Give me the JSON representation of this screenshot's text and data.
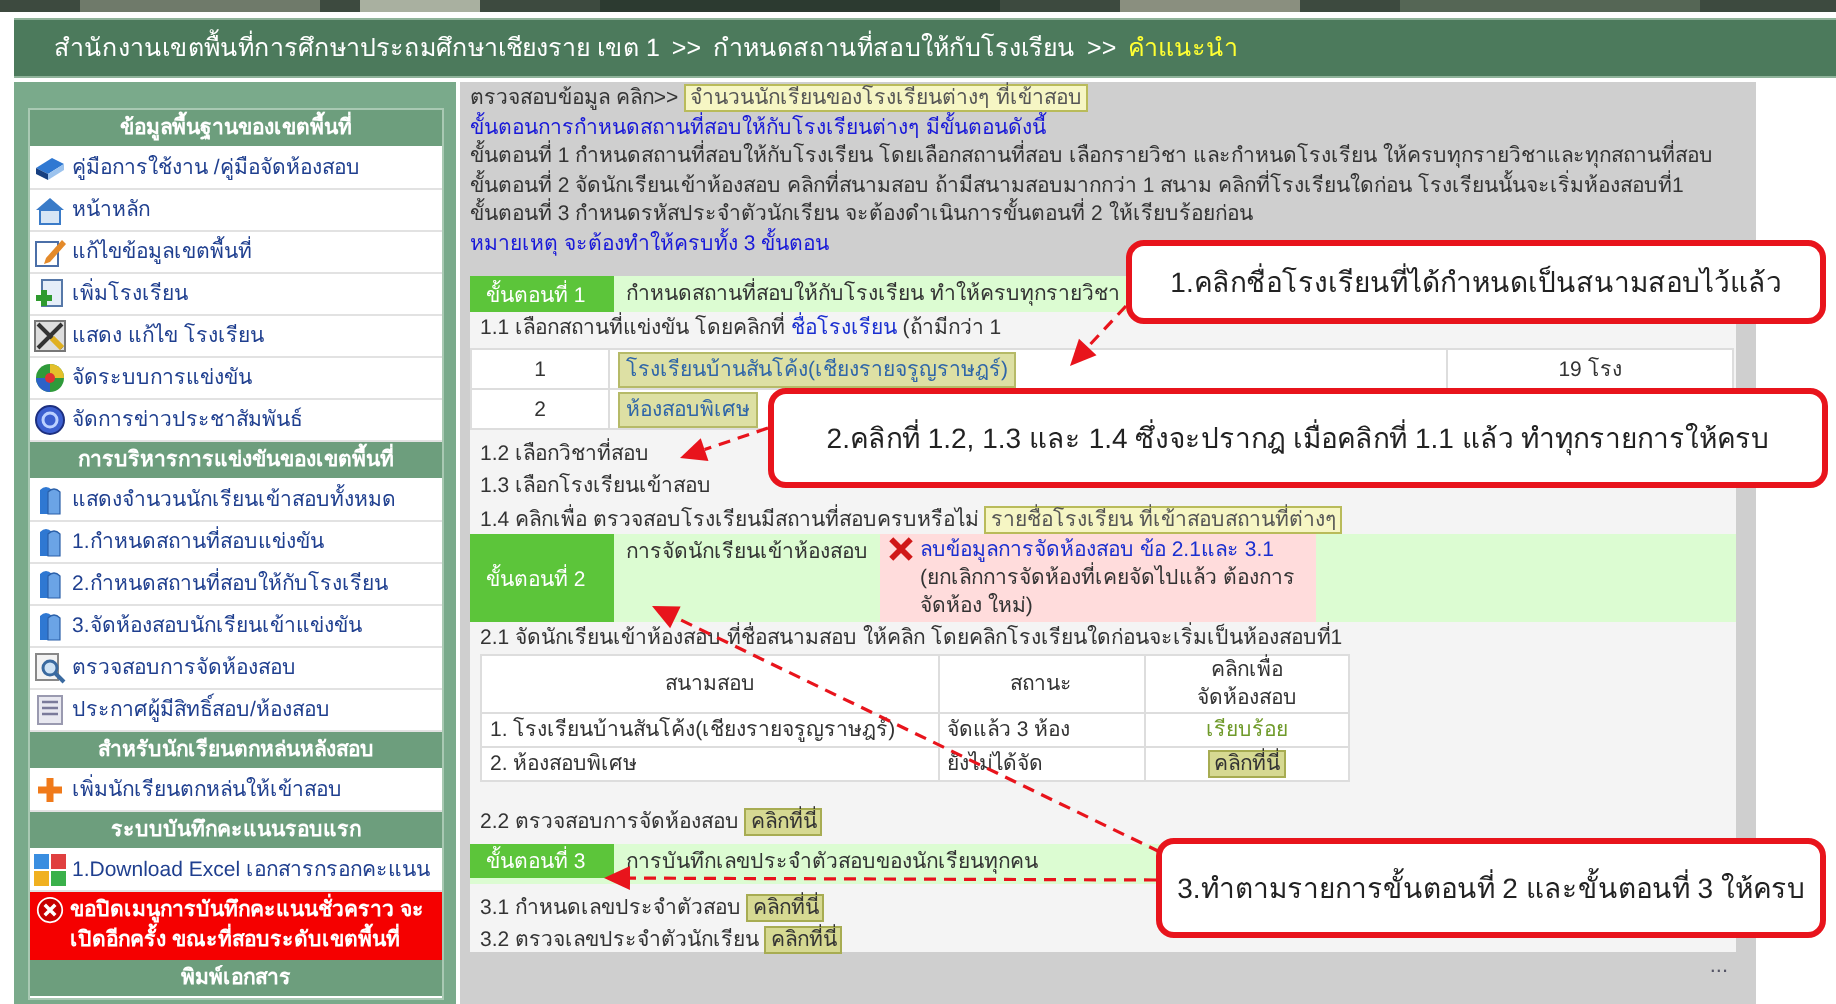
{
  "header": {
    "title": "สำนักงานเขตพื้นที่การศึกษาประถมศึกษาเชียงราย เขต 1",
    "crumbs": [
      {
        "separator": ">>",
        "label": "กำหนดสถานที่สอบให้กับโรงเรียน",
        "current": false
      },
      {
        "separator": ">>",
        "label": "คำแนะนำ",
        "current": true
      }
    ]
  },
  "sidebar": {
    "sections": [
      {
        "title": "ข้อมูลพื้นฐานของเขตพื้นที่",
        "items": [
          {
            "kind": "link",
            "label": "คู่มือการใช้งาน /คู่มือจัดห้องสอบ"
          },
          {
            "kind": "link",
            "label": "หน้าหลัก"
          },
          {
            "kind": "link",
            "label": "แก้ไขข้อมูลเขตพื้นที่"
          },
          {
            "kind": "link",
            "label": "เพิ่มโรงเรียน"
          },
          {
            "kind": "link",
            "label": "แสดง แก้ไข โรงเรียน"
          },
          {
            "kind": "link",
            "label": "จัดระบบการแข่งขัน"
          },
          {
            "kind": "link",
            "label": "จัดการข่าวประชาสัมพันธ์"
          }
        ]
      },
      {
        "title": "การบริหารการแข่งขันของเขตพื้นที่",
        "items": [
          {
            "kind": "link",
            "label": "แสดงจำนวนนักเรียนเข้าสอบทั้งหมด"
          },
          {
            "kind": "link",
            "label": "1.กำหนดสถานที่สอบแข่งขัน"
          },
          {
            "kind": "link",
            "label": "2.กำหนดสถานที่สอบให้กับโรงเรียน"
          },
          {
            "kind": "link",
            "label": "3.จัดห้องสอบนักเรียนเข้าแข่งขัน"
          },
          {
            "kind": "link",
            "label": "ตรวจสอบการจัดห้องสอบ"
          },
          {
            "kind": "link",
            "label": "ประกาศผู้มีสิทธิ์สอบ/ห้องสอบ"
          }
        ]
      },
      {
        "title": "สำหรับนักเรียนตกหล่นหลังสอบ",
        "items": [
          {
            "kind": "link",
            "label": "เพิ่มนักเรียนตกหล่นให้เข้าสอบ"
          }
        ]
      },
      {
        "title": "ระบบบันทึกคะแนนรอบแรก",
        "items": [
          {
            "kind": "link",
            "label": "1.Download Excel เอกสารกรอกคะแนน"
          },
          {
            "kind": "alert",
            "label": "ขอปิดเมนูการบันทึกคะแนนชั่วคราว จะเปิดอีกครั้ง ขณะที่สอบระดับเขตพื้นที่"
          }
        ]
      },
      {
        "title": "พิมพ์เอกสาร"
      }
    ]
  },
  "intro": {
    "prompt": "ตรวจสอบข้อมูล คลิก>>",
    "link": "จำนวนนักเรียนของโรงเรียนต่างๆ ที่เข้าสอบ",
    "heading": "ขั้นตอนการกำหนดสถานที่สอบให้กับโรงเรียนต่างๆ มีขั้นตอนดังนี้",
    "lines": [
      "ขั้นตอนที่ 1 กำหนดสถานที่สอบให้กับโรงเรียน โดยเลือกสถานที่สอบ เลือกรายวิชา และกำหนดโรงเรียน ให้ครบทุกรายวิชาและทุกสถานที่สอบ",
      "ขั้นตอนที่ 2 จัดนักเรียนเข้าห้องสอบ คลิกที่สนามสอบ ถ้ามีสนามสอบมากกว่า 1 สนาม คลิกที่โรงเรียนใดก่อน โรงเรียนนั้นจะเริ่มห้องสอบที่1",
      "ขั้นตอนที่ 3 กำหนดรหัสประจำตัวนักเรียน จะต้องดำเนินการขั้นตอนที่ 2 ให้เรียบร้อยก่อน"
    ],
    "note": "หมายเหตุ จะต้องทำให้ครบทั้ง 3 ขั้นตอน"
  },
  "step1": {
    "badge": "ขั้นตอนที่ 1",
    "title": "กำหนดสถานที่สอบให้กับโรงเรียน ทำให้ครบทุกรายวิชา",
    "choose_site": {
      "text": "1.1 เลือกสถานที่แข่งขัน โดยคลิกที่",
      "link": "ชื่อโรงเรียน",
      "after": "(ถ้ามีกว่า 1"
    },
    "sites": [
      {
        "no": "1",
        "name": "โรงเรียนบ้านสันโค้ง(เชียงรายจรูญราษฎร์)",
        "count": "19 โรง"
      },
      {
        "no": "2",
        "name": "ห้องสอบพิเศษ"
      }
    ],
    "choose_subject": "1.2 เลือกวิชาที่สอบ",
    "choose_school": "1.3 เลือกโรงเรียนเข้าสอบ",
    "check": {
      "text": "1.4 คลิกเพื่อ ตรวจสอบโรงเรียนมีสถานที่สอบครบหรือไม่",
      "link": "รายชื่อโรงเรียน ที่เข้าสอบสถานที่ต่างๆ"
    }
  },
  "step2": {
    "badge": "ขั้นตอนที่ 2",
    "title": "การจัดนักเรียนเข้าห้องสอบ",
    "delete": {
      "link": "ลบข้อมูลการจัดห้องสอบ ข้อ 2.1และ 3.1",
      "note": "(ยกเลิกการจัดห้องที่เคยจัดไปแล้ว ต้องการจัดห้อง ใหม่)"
    },
    "assign": "2.1 จัดนักเรียนเข้าห้องสอบ ที่ชื่อสนามสอบ ให้คลิก โดยคลิกโรงเรียนใดก่อนจะเริ่มเป็นห้องสอบที่1",
    "columns": [
      "สนามสอบ",
      "สถานะ",
      "คลิกเพื่อ\nจัดห้องสอบ"
    ],
    "rows": [
      {
        "site": "1. โรงเรียนบ้านสันโค้ง(เชียงรายจรูญราษฎร์)",
        "status": "จัดแล้ว 3 ห้อง",
        "action": {
          "kind": "done",
          "label": "เรียบร้อย"
        }
      },
      {
        "site": "2. ห้องสอบพิเศษ",
        "status": "ยังไม่ได้จัด",
        "action": {
          "kind": "button",
          "label": "คลิกที่นี่"
        }
      }
    ],
    "review": {
      "text": "2.2 ตรวจสอบการจัดห้องสอบ",
      "button": "คลิกที่นี่"
    }
  },
  "step3": {
    "badge": "ขั้นตอนที่ 3",
    "title": "การบันทึกเลขประจำตัวสอบของนักเรียนทุกคน",
    "actions": [
      {
        "text": "3.1 กำหนดเลขประจำตัวสอบ",
        "button": "คลิกที่นี่"
      },
      {
        "text": "3.2 ตรวจเลขประจำตัวนักเรียน",
        "button": "คลิกที่นี่"
      }
    ]
  },
  "more": "...",
  "callouts": [
    {
      "text": "1.คลิกชื่อโรงเรียนที่ได้กำหนดเป็นสนามสอบไว้แล้ว"
    },
    {
      "text": "2.คลิกที่ 1.2, 1.3 และ 1.4 ซึ่งจะปรากฎ เมื่อคลิกที่ 1.1 แล้ว ทำทุกรายการให้ครบ"
    },
    {
      "text": "3.ทำตามรายการขั้นตอนที่ 2 และขั้นตอนที่ 3 ให้ครบ"
    }
  ]
}
